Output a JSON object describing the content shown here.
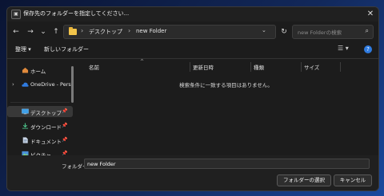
{
  "window": {
    "title": "保存先のフォルダーを指定してください...",
    "app_icon": "folder-picker-icon",
    "close_glyph": "✕"
  },
  "nav": {
    "back": "←",
    "forward": "→",
    "recent_dropdown": "⌄",
    "up": "↑",
    "refresh": "↻"
  },
  "address": {
    "breadcrumbs": [
      "デスクトップ",
      "new Folder"
    ],
    "separator": "›",
    "dropdown": "⌄"
  },
  "search": {
    "placeholder": "new Folderの検索",
    "icon": "⌕"
  },
  "toolbar": {
    "organize": "整理 ▾",
    "new_folder": "新しいフォルダー",
    "view_icon": "☰ ▾",
    "help": "?"
  },
  "sidebar": {
    "items": [
      {
        "label": "ホーム",
        "icon": "home-icon"
      },
      {
        "label": "OneDrive - Pers",
        "icon": "onedrive-icon",
        "chevron": "›"
      },
      {
        "label": "デスクトップ",
        "icon": "desktop-icon",
        "pin": "📌"
      },
      {
        "label": "ダウンロード",
        "icon": "download-icon",
        "pin": "📌"
      },
      {
        "label": "ドキュメント",
        "icon": "document-icon",
        "pin": "📌"
      },
      {
        "label": "ピクチャ",
        "icon": "pictures-icon",
        "pin": "📌"
      }
    ]
  },
  "columns": {
    "name": "名前",
    "modified": "更新日時",
    "type": "種類",
    "size": "サイズ",
    "sort_caret": "^"
  },
  "empty_message": "検索条件に一致する項目はありません。",
  "footer": {
    "folder_label": "フォルダー:",
    "folder_value": "new Folder",
    "select_button": "フォルダーの選択",
    "cancel_button": "キャンセル"
  },
  "colors": {
    "dialog_bg": "#1c1c1c",
    "accent": "#2f7be0",
    "folder": "#f2c44a"
  }
}
